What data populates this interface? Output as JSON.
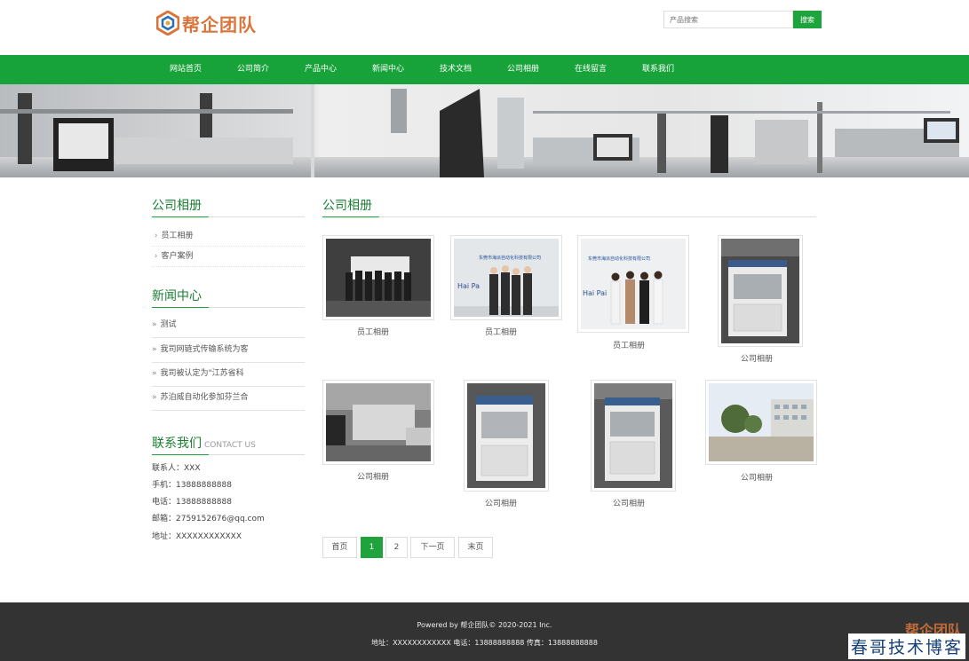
{
  "header": {
    "logo_text": "帮企团队",
    "search_placeholder": "产品搜索",
    "search_button": "搜索"
  },
  "nav": {
    "items": [
      "网站首页",
      "公司简介",
      "产品中心",
      "新闻中心",
      "技术文档",
      "公司相册",
      "在线留言",
      "联系我们"
    ]
  },
  "sidebar": {
    "album_title": "公司相册",
    "album_items": [
      "员工相册",
      "客户案例"
    ],
    "news_title": "新闻中心",
    "news_items": [
      "测试",
      "我司网链式传输系统为客",
      "我司被认定为\"江苏省科",
      "苏泊威自动化参加芬兰合"
    ],
    "contact_title": "联系我们",
    "contact_subtitle": "CONTACT US",
    "contact_lines": [
      "联系人：XXX",
      "手机：13888888888",
      "电话：13888888888",
      "邮箱：2759152676@qq.com",
      "地址：XXXXXXXXXXXX"
    ]
  },
  "main": {
    "title": "公司相册",
    "photos": [
      {
        "caption": "员工相册"
      },
      {
        "caption": "员工相册"
      },
      {
        "caption": "员工相册"
      },
      {
        "caption": "公司相册"
      },
      {
        "caption": "公司相册"
      },
      {
        "caption": "公司相册"
      },
      {
        "caption": "公司相册"
      },
      {
        "caption": "公司相册"
      }
    ],
    "photo_sign_text": "东莞市海派自动化科技有限公司",
    "pager": [
      "首页",
      "1",
      "2",
      "下一页",
      "末页"
    ]
  },
  "footer": {
    "line1": "Powered by 帮企团队© 2020-2021 Inc.",
    "line2": "地址：XXXXXXXXXXXX 电话：13888888888 传真：13888888888"
  },
  "watermark": {
    "text": "春哥技术博客",
    "logo_text": "帮企团队"
  },
  "colors": {
    "primary_green": "#1fa33c",
    "footer_bg": "#333333",
    "logo_orange": "#d9743b"
  }
}
